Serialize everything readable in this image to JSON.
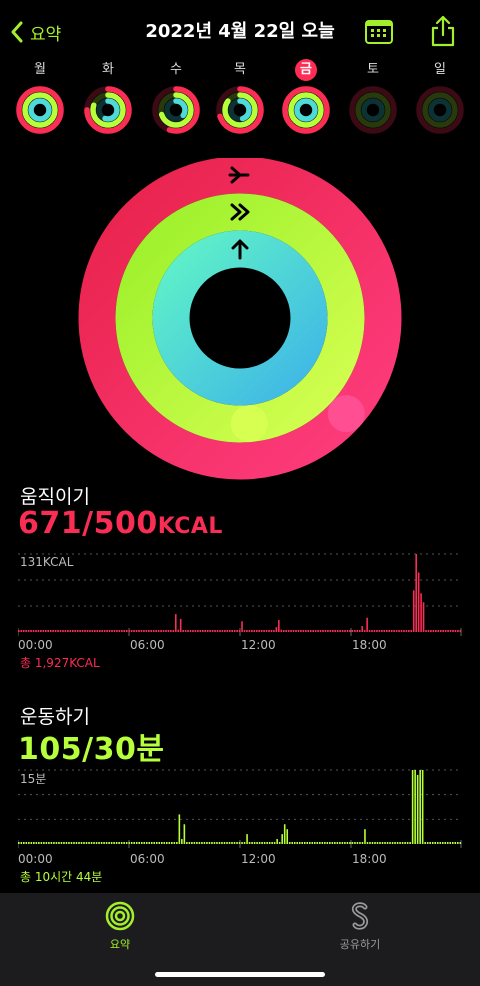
{
  "nav": {
    "back_label": "요약",
    "title": "2022년 4월 22일 오늘"
  },
  "week": {
    "days": [
      "월",
      "화",
      "수",
      "목",
      "금",
      "토",
      "일"
    ],
    "selected": "금",
    "rings": [
      {
        "move": 1.0,
        "exercise": 1.0,
        "stand": 1.0
      },
      {
        "move": 0.75,
        "exercise": 0.8,
        "stand": 0.55
      },
      {
        "move": 0.55,
        "exercise": 0.7,
        "stand": 0.35
      },
      {
        "move": 0.7,
        "exercise": 0.85,
        "stand": 0.45
      },
      {
        "move": 1.0,
        "exercise": 1.0,
        "stand": 1.0
      },
      {
        "move": 0,
        "exercise": 0,
        "stand": 0
      },
      {
        "move": 0,
        "exercise": 0,
        "stand": 0
      }
    ]
  },
  "big_ring": {
    "move_fraction": 1.34,
    "exercise_fraction": 3.5,
    "stand_fraction": 1.0
  },
  "move": {
    "title": "움직이기",
    "value": "671/500",
    "unit": "KCAL",
    "axis_max_label": "131KCAL",
    "total": "총 1,927KCAL",
    "color": "#fa2d55"
  },
  "exercise": {
    "title": "운동하기",
    "value": "105/30분",
    "axis_max_label": "15분",
    "total": "총 10시간 44분",
    "color": "#b6ff3a"
  },
  "time_labels": [
    "00:00",
    "06:00",
    "12:00",
    "18:00"
  ],
  "chart_data": [
    {
      "type": "bar",
      "title": "움직이기",
      "ylabel": "131KCAL",
      "x_ticks": [
        "00:00",
        "06:00",
        "12:00",
        "18:00"
      ],
      "ylim": [
        0,
        131
      ],
      "series": [
        {
          "values": [
            2,
            2,
            2,
            2,
            2,
            2,
            2,
            2,
            2,
            2,
            2,
            2,
            2,
            2,
            2,
            2,
            2,
            2,
            2,
            2,
            2,
            2,
            2,
            2,
            2,
            2,
            2,
            2,
            2,
            2,
            2,
            2,
            2,
            2,
            2,
            2,
            2,
            2,
            2,
            2,
            2,
            2,
            2,
            2,
            2,
            2,
            2,
            2,
            2,
            2,
            2,
            2,
            2,
            2,
            2,
            2,
            2,
            2,
            2,
            2,
            2,
            2,
            2,
            2,
            30,
            4,
            22,
            3,
            2,
            2,
            2,
            2,
            2,
            2,
            2,
            2,
            2,
            2,
            2,
            2,
            3,
            2,
            2,
            2,
            2,
            2,
            2,
            2,
            2,
            2,
            2,
            18,
            2,
            2,
            2,
            2,
            2,
            2,
            2,
            2,
            2,
            2,
            2,
            3,
            2,
            8,
            20,
            4,
            2,
            2,
            2,
            2,
            2,
            2,
            2,
            2,
            2,
            2,
            2,
            2,
            2,
            2,
            2,
            2,
            2,
            2,
            2,
            2,
            2,
            2,
            2,
            2,
            2,
            2,
            2,
            2,
            2,
            2,
            3,
            2,
            10,
            2,
            24,
            3,
            2,
            2,
            2,
            2,
            2,
            2,
            2,
            2,
            2,
            2,
            2,
            2,
            2,
            2,
            2,
            2,
            2,
            70,
            132,
            100,
            65,
            50,
            2,
            2,
            2,
            2,
            2,
            2,
            2,
            2,
            2,
            2,
            2,
            2,
            2,
            2,
            2
          ]
        }
      ]
    },
    {
      "type": "bar",
      "title": "운동하기",
      "ylabel": "15분",
      "x_ticks": [
        "00:00",
        "06:00",
        "12:00",
        "18:00"
      ],
      "ylim": [
        0,
        15
      ],
      "series": [
        {
          "values": [
            0.3,
            0.3,
            0.3,
            0.3,
            0.3,
            0.3,
            0.3,
            0.3,
            0.3,
            0.3,
            0.3,
            0.3,
            0.3,
            0.3,
            0.3,
            0.3,
            0.3,
            0.3,
            0.3,
            0.3,
            0.3,
            0.3,
            0.3,
            0.3,
            0.3,
            0.3,
            0.3,
            0.3,
            0.3,
            0.3,
            0.3,
            0.3,
            0.3,
            0.3,
            0.3,
            0.3,
            0.3,
            0.3,
            0.3,
            0.3,
            0.3,
            0.3,
            0.3,
            0.3,
            0.3,
            0.3,
            0.3,
            0.3,
            0.3,
            0.3,
            0.3,
            0.3,
            0.3,
            0.3,
            0.3,
            0.3,
            0.3,
            0.3,
            0.3,
            0.3,
            0.3,
            0.3,
            0.3,
            0.3,
            6,
            1,
            4,
            0.3,
            0.3,
            0.3,
            0.3,
            0.3,
            0.3,
            0.3,
            0.3,
            0.3,
            0.3,
            0.3,
            0.3,
            0.3,
            0.3,
            0.3,
            0.3,
            0.3,
            0.3,
            0.3,
            0.3,
            0.3,
            0.3,
            0.3,
            0.3,
            2,
            0.3,
            0.3,
            0.3,
            0.3,
            0.3,
            0.3,
            0.3,
            0.3,
            0.3,
            0.3,
            0.3,
            1,
            0.3,
            2,
            4,
            3,
            0.3,
            0.3,
            0.3,
            0.3,
            0.3,
            0.3,
            0.3,
            0.3,
            0.3,
            0.3,
            0.3,
            0.3,
            0.3,
            0.3,
            0.3,
            0.3,
            0.3,
            0.3,
            0.3,
            0.3,
            0.3,
            0.3,
            0.3,
            0.3,
            0.3,
            0.3,
            0.3,
            0.3,
            0.3,
            0.3,
            3,
            0.3,
            0.3,
            0.3,
            0.3,
            0.3,
            0.3,
            0.3,
            0.3,
            0.3,
            0.3,
            0.3,
            0.3,
            0.3,
            0.3,
            0.3,
            0.3,
            0.3,
            0.3,
            15,
            15,
            14,
            15,
            15,
            0.3,
            0.3,
            0.3,
            0.3,
            0.3,
            0.3,
            0.3,
            0.3,
            0.3,
            0.3,
            0.3,
            0.3,
            0.3,
            0.3,
            0.3
          ]
        }
      ]
    }
  ],
  "tabs": [
    {
      "label": "요약",
      "icon": "activity-rings-icon",
      "active": true
    },
    {
      "label": "공유하기",
      "icon": "sharing-icon",
      "active": false
    }
  ],
  "colors": {
    "accent": "#a3f02a",
    "move": "#fa2d55",
    "exercise": "#b6ff3a",
    "stand": "#4fd9d9"
  }
}
